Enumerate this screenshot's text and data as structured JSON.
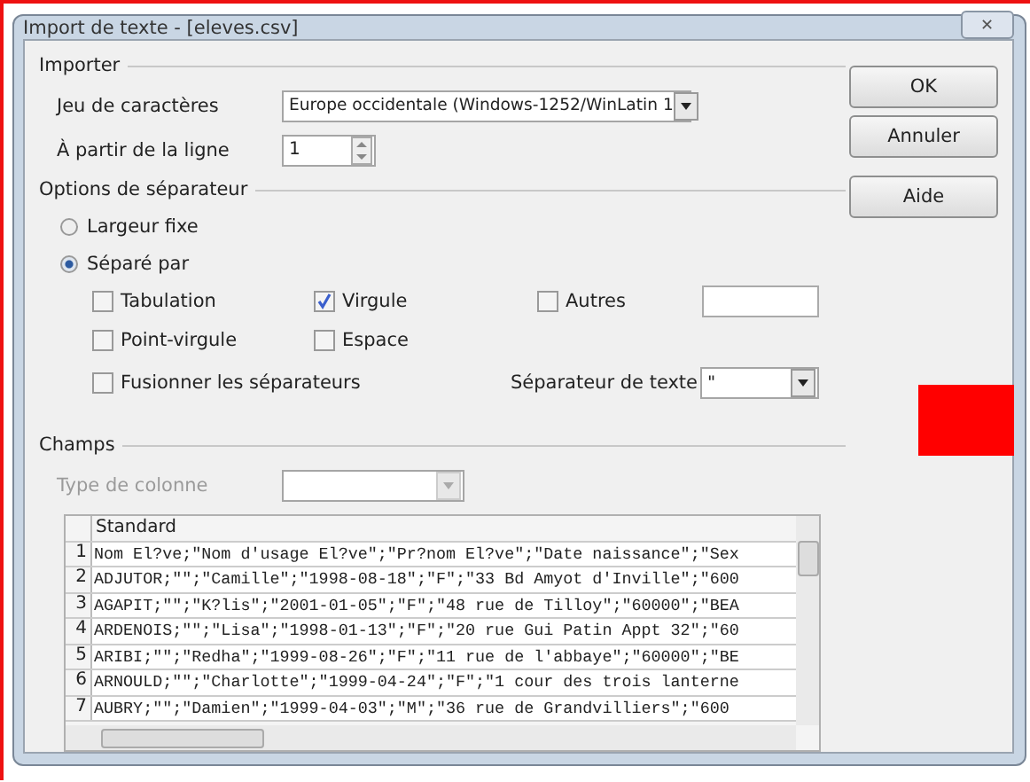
{
  "window": {
    "title": "Import de texte - [eleves.csv]",
    "close": "✕"
  },
  "import": {
    "title": "Importer",
    "charset_label": "Jeu de caractères",
    "charset_value": "Europe occidentale (Windows-1252/WinLatin 1",
    "start_label": "À partir de la ligne",
    "start_value": "1"
  },
  "separator_options": {
    "title": "Options de séparateur",
    "modes": [
      {
        "label": "Largeur fixe",
        "selected": false
      },
      {
        "label": "Séparé par",
        "selected": true
      }
    ],
    "checks": [
      {
        "label": "Tabulation",
        "checked": false
      },
      {
        "label": "Virgule",
        "checked": true
      },
      {
        "label": "Autres",
        "checked": false
      },
      {
        "label": "Point-virgule",
        "checked": false
      },
      {
        "label": "Espace",
        "checked": false
      }
    ],
    "merge": {
      "label": "Fusionner les séparateurs",
      "checked": false
    },
    "text_separator_label": "Séparateur de texte",
    "text_separator_value": "\""
  },
  "fields": {
    "title": "Champs",
    "column_type_label": "Type de colonne",
    "column_type_disabled": true,
    "preview": {
      "header": "Standard",
      "rows": [
        {
          "number": "1",
          "text": "Nom El?ve;\"Nom d'usage El?ve\";\"Pr?nom El?ve\";\"Date naissance\";\"Sex"
        },
        {
          "number": "2",
          "text": "ADJUTOR;\"\";\"Camille\";\"1998-08-18\";\"F\";\"33 Bd Amyot d'Inville\";\"600"
        },
        {
          "number": "3",
          "text": "AGAPIT;\"\";\"K?lis\";\"2001-01-05\";\"F\";\"48 rue de Tilloy\";\"60000\";\"BEA"
        },
        {
          "number": "4",
          "text": "ARDENOIS;\"\";\"Lisa\";\"1998-01-13\";\"F\";\"20 rue Gui Patin Appt 32\";\"60"
        },
        {
          "number": "5",
          "text": "ARIBI;\"\";\"Redha\";\"1999-08-26\";\"F\";\"11 rue de l'abbaye\";\"60000\";\"BE"
        },
        {
          "number": "6",
          "text": "ARNOULD;\"\";\"Charlotte\";\"1999-04-24\";\"F\";\"1 cour des trois lanterne"
        },
        {
          "number": "7",
          "text": "AUBRY;\"\";\"Damien\";\"1999-04-03\";\"M\";\"36 rue de Grandvilliers\";\"600"
        }
      ]
    }
  },
  "buttons": [
    {
      "label": "OK"
    },
    {
      "label": "Annuler"
    },
    {
      "label": "Aide"
    }
  ]
}
